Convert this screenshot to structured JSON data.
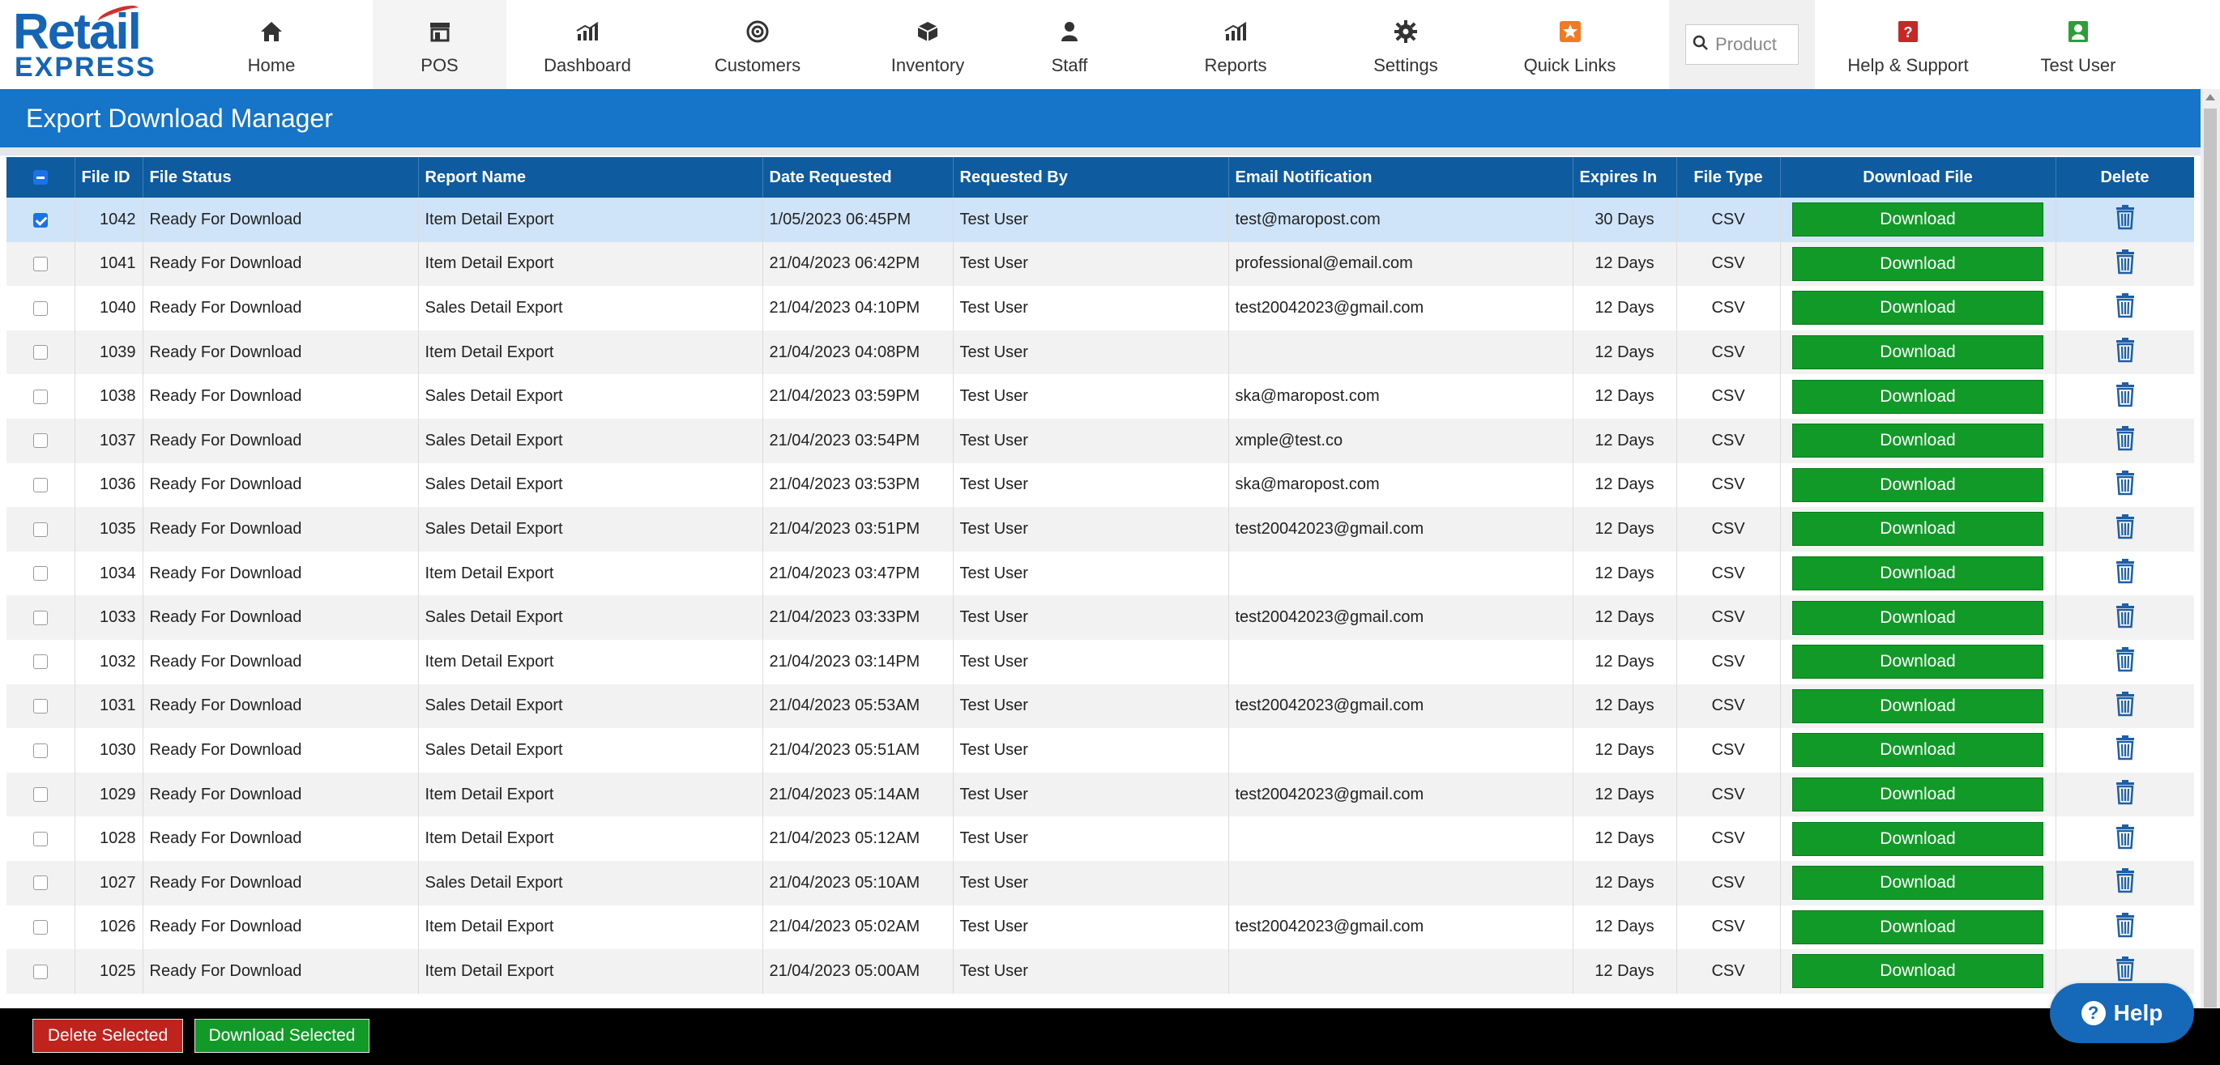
{
  "brand": {
    "line1": "Retail",
    "line2": "EXPRESS"
  },
  "nav": [
    {
      "id": "home",
      "label": "Home",
      "icon": "home-icon"
    },
    {
      "id": "pos",
      "label": "POS",
      "icon": "store-icon"
    },
    {
      "id": "dashboard",
      "label": "Dashboard",
      "icon": "bar-chart-icon"
    },
    {
      "id": "customers",
      "label": "Customers",
      "icon": "target-icon"
    },
    {
      "id": "inventory",
      "label": "Inventory",
      "icon": "box-icon"
    },
    {
      "id": "staff",
      "label": "Staff",
      "icon": "person-icon"
    },
    {
      "id": "reports",
      "label": "Reports",
      "icon": "bar-chart-icon"
    },
    {
      "id": "settings",
      "label": "Settings",
      "icon": "gear-icon"
    },
    {
      "id": "quicklinks",
      "label": "Quick Links",
      "icon": "star-icon"
    }
  ],
  "search": {
    "placeholder": "Product"
  },
  "nav_right": [
    {
      "id": "help",
      "label": "Help & Support",
      "icon": "question-icon"
    },
    {
      "id": "user",
      "label": "Test User",
      "icon": "user-icon"
    }
  ],
  "page": {
    "title": "Export Download Manager"
  },
  "table": {
    "headers": {
      "file_id": "File ID",
      "file_status": "File Status",
      "report_name": "Report Name",
      "date_requested": "Date Requested",
      "requested_by": "Requested By",
      "email": "Email Notification",
      "expires": "Expires In",
      "file_type": "File Type",
      "download": "Download File",
      "delete": "Delete"
    },
    "download_label": "Download",
    "rows": [
      {
        "id": "1042",
        "status": "Ready For Download",
        "report": "Item Detail Export",
        "date": "1/05/2023 06:45PM",
        "by": "Test User",
        "email": "test@maropost.com",
        "expires": "30 Days",
        "type": "CSV",
        "checked": true
      },
      {
        "id": "1041",
        "status": "Ready For Download",
        "report": "Item Detail Export",
        "date": "21/04/2023 06:42PM",
        "by": "Test User",
        "email": "professional@email.com",
        "expires": "12 Days",
        "type": "CSV",
        "checked": false
      },
      {
        "id": "1040",
        "status": "Ready For Download",
        "report": "Sales Detail Export",
        "date": "21/04/2023 04:10PM",
        "by": "Test User",
        "email": "test20042023@gmail.com",
        "expires": "12 Days",
        "type": "CSV",
        "checked": false
      },
      {
        "id": "1039",
        "status": "Ready For Download",
        "report": "Item Detail Export",
        "date": "21/04/2023 04:08PM",
        "by": "Test User",
        "email": "",
        "expires": "12 Days",
        "type": "CSV",
        "checked": false
      },
      {
        "id": "1038",
        "status": "Ready For Download",
        "report": "Sales Detail Export",
        "date": "21/04/2023 03:59PM",
        "by": "Test User",
        "email": "ska@maropost.com",
        "expires": "12 Days",
        "type": "CSV",
        "checked": false
      },
      {
        "id": "1037",
        "status": "Ready For Download",
        "report": "Sales Detail Export",
        "date": "21/04/2023 03:54PM",
        "by": "Test User",
        "email": "xmple@test.co",
        "expires": "12 Days",
        "type": "CSV",
        "checked": false
      },
      {
        "id": "1036",
        "status": "Ready For Download",
        "report": "Sales Detail Export",
        "date": "21/04/2023 03:53PM",
        "by": "Test User",
        "email": "ska@maropost.com",
        "expires": "12 Days",
        "type": "CSV",
        "checked": false
      },
      {
        "id": "1035",
        "status": "Ready For Download",
        "report": "Sales Detail Export",
        "date": "21/04/2023 03:51PM",
        "by": "Test User",
        "email": "test20042023@gmail.com",
        "expires": "12 Days",
        "type": "CSV",
        "checked": false
      },
      {
        "id": "1034",
        "status": "Ready For Download",
        "report": "Item Detail Export",
        "date": "21/04/2023 03:47PM",
        "by": "Test User",
        "email": "",
        "expires": "12 Days",
        "type": "CSV",
        "checked": false
      },
      {
        "id": "1033",
        "status": "Ready For Download",
        "report": "Sales Detail Export",
        "date": "21/04/2023 03:33PM",
        "by": "Test User",
        "email": "test20042023@gmail.com",
        "expires": "12 Days",
        "type": "CSV",
        "checked": false
      },
      {
        "id": "1032",
        "status": "Ready For Download",
        "report": "Item Detail Export",
        "date": "21/04/2023 03:14PM",
        "by": "Test User",
        "email": "",
        "expires": "12 Days",
        "type": "CSV",
        "checked": false
      },
      {
        "id": "1031",
        "status": "Ready For Download",
        "report": "Sales Detail Export",
        "date": "21/04/2023 05:53AM",
        "by": "Test User",
        "email": "test20042023@gmail.com",
        "expires": "12 Days",
        "type": "CSV",
        "checked": false
      },
      {
        "id": "1030",
        "status": "Ready For Download",
        "report": "Sales Detail Export",
        "date": "21/04/2023 05:51AM",
        "by": "Test User",
        "email": "",
        "expires": "12 Days",
        "type": "CSV",
        "checked": false
      },
      {
        "id": "1029",
        "status": "Ready For Download",
        "report": "Item Detail Export",
        "date": "21/04/2023 05:14AM",
        "by": "Test User",
        "email": "test20042023@gmail.com",
        "expires": "12 Days",
        "type": "CSV",
        "checked": false
      },
      {
        "id": "1028",
        "status": "Ready For Download",
        "report": "Item Detail Export",
        "date": "21/04/2023 05:12AM",
        "by": "Test User",
        "email": "",
        "expires": "12 Days",
        "type": "CSV",
        "checked": false
      },
      {
        "id": "1027",
        "status": "Ready For Download",
        "report": "Sales Detail Export",
        "date": "21/04/2023 05:10AM",
        "by": "Test User",
        "email": "",
        "expires": "12 Days",
        "type": "CSV",
        "checked": false
      },
      {
        "id": "1026",
        "status": "Ready For Download",
        "report": "Item Detail Export",
        "date": "21/04/2023 05:02AM",
        "by": "Test User",
        "email": "test20042023@gmail.com",
        "expires": "12 Days",
        "type": "CSV",
        "checked": false
      },
      {
        "id": "1025",
        "status": "Ready For Download",
        "report": "Item Detail Export",
        "date": "21/04/2023 05:00AM",
        "by": "Test User",
        "email": "",
        "expires": "12 Days",
        "type": "CSV",
        "checked": false
      }
    ]
  },
  "footer": {
    "delete_selected": "Delete Selected",
    "download_selected": "Download Selected"
  },
  "help_widget": {
    "label": "Help"
  },
  "colors": {
    "header_blue": "#1674c9",
    "table_header": "#0e5b9f",
    "download_green": "#119a27",
    "delete_red": "#c0231e"
  }
}
